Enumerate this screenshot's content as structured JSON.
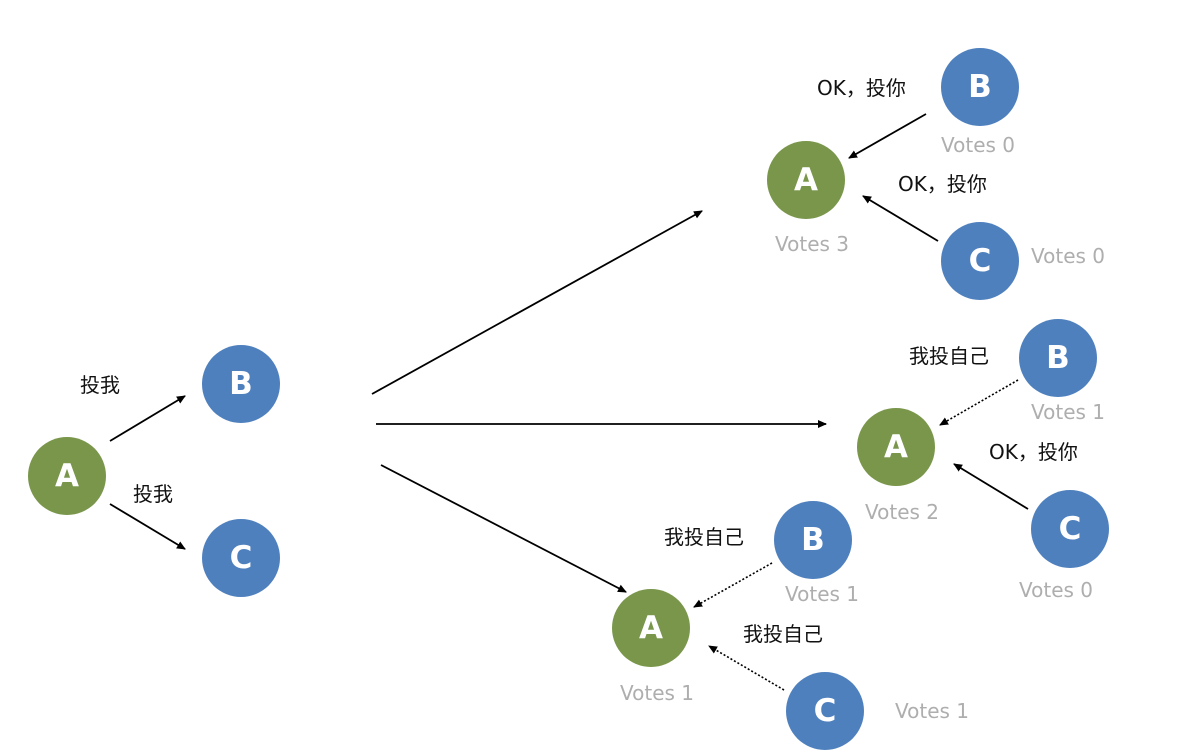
{
  "colors": {
    "candidate": "#79964B",
    "voter": "#4F80BE",
    "votes_text": "#AEAEAE"
  },
  "initial": {
    "node_a": "A",
    "node_b": "B",
    "node_c": "C",
    "msg_to_b": "投我",
    "msg_to_c": "投我"
  },
  "scenario_top": {
    "node_a": "A",
    "node_b": "B",
    "node_c": "C",
    "votes_a": "Votes 3",
    "votes_b": "Votes 0",
    "votes_c": "Votes 0",
    "msg_b": "OK，投你",
    "msg_c": "OK，投你"
  },
  "scenario_middle": {
    "node_a": "A",
    "node_b": "B",
    "node_c": "C",
    "votes_a": "Votes 2",
    "votes_b": "Votes 1",
    "votes_c": "Votes 0",
    "msg_b": "我投自己",
    "msg_c": "OK，投你"
  },
  "scenario_bottom": {
    "node_a": "A",
    "node_b": "B",
    "node_c": "C",
    "votes_a": "Votes 1",
    "votes_b": "Votes 1",
    "votes_c": "Votes 1",
    "msg_b": "我投自己",
    "msg_c": "我投自己"
  }
}
